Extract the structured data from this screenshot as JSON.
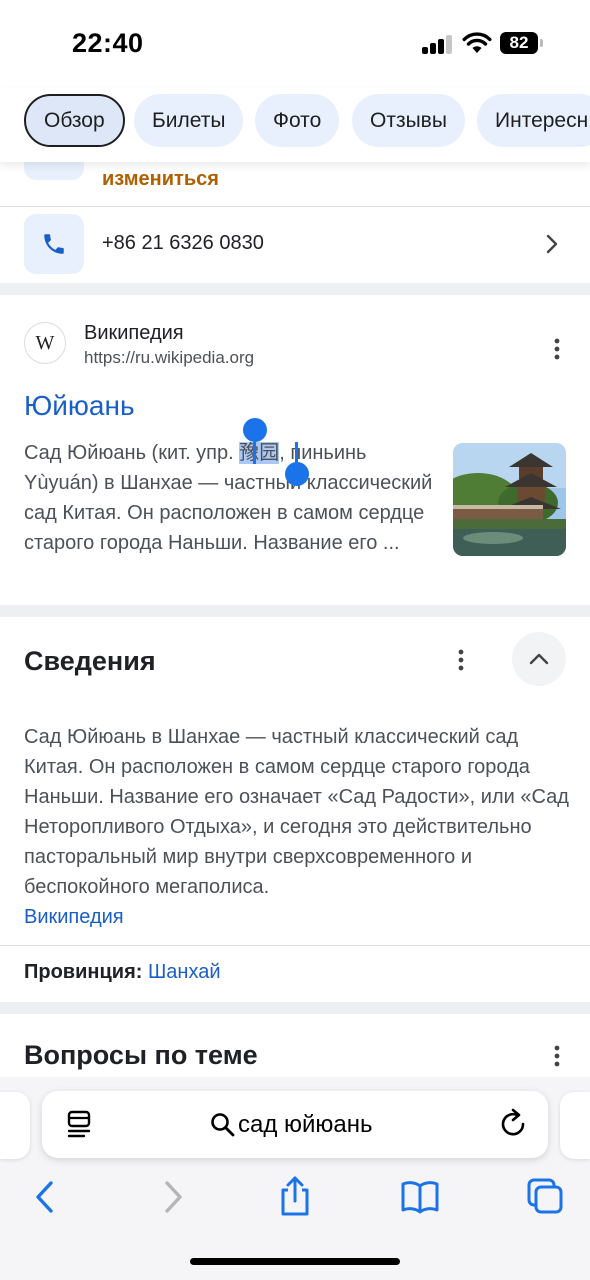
{
  "status": {
    "time": "22:40",
    "battery": "82"
  },
  "tabs": [
    {
      "label": "Обзор",
      "active": true
    },
    {
      "label": "Билеты",
      "active": false
    },
    {
      "label": "Фото",
      "active": false
    },
    {
      "label": "Отзывы",
      "active": false
    },
    {
      "label": "Интересн",
      "active": false
    }
  ],
  "hours": {
    "note": "измениться"
  },
  "phone": {
    "number": "+86 21 6326 0830"
  },
  "result": {
    "source_name": "Википедия",
    "source_url": "https://ru.wikipedia.org",
    "logo_letter": "W",
    "title": "Юйюань",
    "snippet_before": "Сад Юйюань (кит. упр. ",
    "snippet_selected": "豫园",
    "snippet_after": ", пиньинь Yùyuán) в Шанхае — частный классический сад Китая. Он расположен в самом сердце старого города Наньши. Название его ..."
  },
  "about": {
    "title": "Сведения",
    "description": "Сад Юйюань в Шанхае — частный классический сад Китая. Он расположен в самом сердце старого города Наньши. Название его означает «Сад Радости», или «Сад Неторопливого Отдыха», и сегодня это действительно пасторальный мир внутри сверхсовременного и беспокойного мегаполиса.",
    "source_link": "Википедия",
    "province_label": "Провинция:",
    "province_value": "Шанхай"
  },
  "questions": {
    "title": "Вопросы по теме"
  },
  "browser": {
    "address_query": "сад юйюань"
  },
  "colors": {
    "link": "#1a5fc7",
    "chip_bg": "#e8f0fe",
    "accent": "#1a73e8",
    "warning": "#b06000"
  }
}
